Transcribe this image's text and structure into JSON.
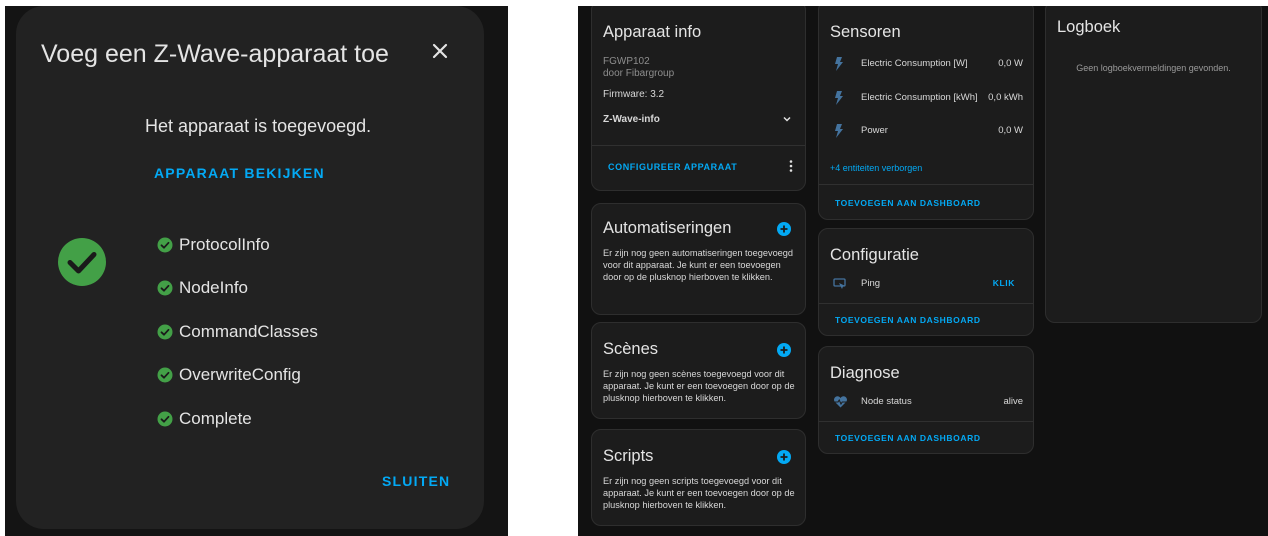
{
  "dialog": {
    "title": "Voeg een Z-Wave-apparaat toe",
    "success_message": "Het apparaat is toegevoegd.",
    "view_device_label": "APPARAAT BEKIJKEN",
    "steps": [
      "ProtocolInfo",
      "NodeInfo",
      "CommandClasses",
      "OverwriteConfig",
      "Complete"
    ],
    "close_label": "SLUITEN"
  },
  "device_info": {
    "title": "Apparaat info",
    "model": "FGWP102",
    "manufacturer": "door Fibargroup",
    "firmware": "Firmware: 3.2",
    "zwave_info_label": "Z-Wave-info",
    "configure_label": "CONFIGUREER APPARAAT"
  },
  "automations": {
    "title": "Automatiseringen",
    "text": "Er zijn nog geen automatiseringen toegevoegd voor dit apparaat. Je kunt er een toevoegen door op de plusknop hierboven te klikken."
  },
  "scenes": {
    "title": "Scènes",
    "text": "Er zijn nog geen scènes toegevoegd voor dit apparaat. Je kunt er een toevoegen door op de plusknop hierboven te klikken."
  },
  "scripts": {
    "title": "Scripts",
    "text": "Er zijn nog geen scripts toegevoegd voor dit apparaat. Je kunt er een toevoegen door op de plusknop hierboven te klikken."
  },
  "sensors": {
    "title": "Sensoren",
    "entities": [
      {
        "name": "Electric Consumption [W]",
        "value": "0,0 W",
        "icon": "flash-icon"
      },
      {
        "name": "Electric Consumption [kWh]",
        "value": "0,0 kWh",
        "icon": "flash-icon"
      },
      {
        "name": "Power",
        "value": "0,0 W",
        "icon": "flash-icon"
      }
    ],
    "hidden_label": "+4 entiteiten verborgen",
    "add_dashboard_label": "TOEVOEGEN AAN DASHBOARD"
  },
  "configuration": {
    "title": "Configuratie",
    "ping_label": "Ping",
    "ping_action": "KLIK",
    "add_dashboard_label": "TOEVOEGEN AAN DASHBOARD"
  },
  "diagnostics": {
    "title": "Diagnose",
    "node_status_label": "Node status",
    "node_status_value": "alive",
    "add_dashboard_label": "TOEVOEGEN AAN DASHBOARD"
  },
  "logbook": {
    "title": "Logboek",
    "empty_text": "Geen logboekvermeldingen gevonden."
  },
  "colors": {
    "accent": "#03a9f4",
    "success": "#43a047",
    "card_bg": "#1c1c1c",
    "dialog_bg": "#222222"
  }
}
